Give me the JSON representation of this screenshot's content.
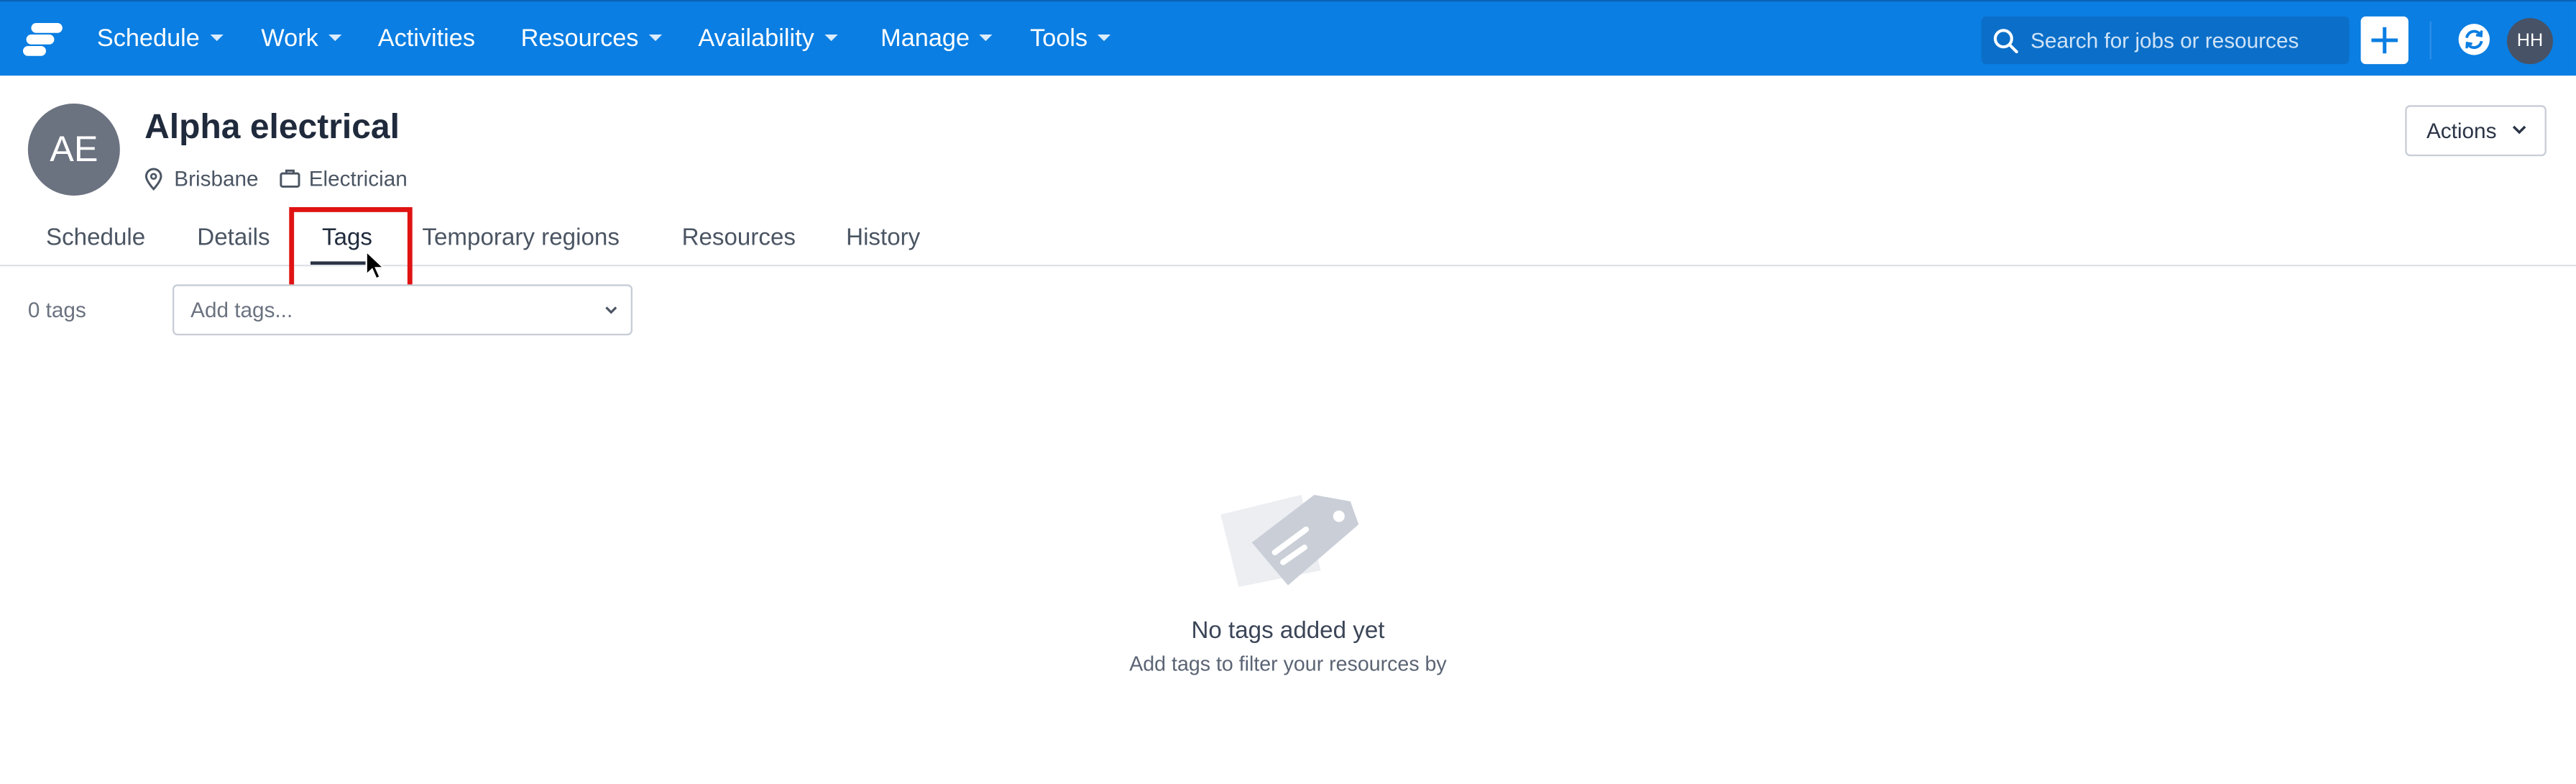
{
  "topbar": {
    "nav": [
      {
        "label": "Schedule"
      },
      {
        "label": "Work"
      },
      {
        "label": "Activities"
      },
      {
        "label": "Resources"
      },
      {
        "label": "Availability"
      },
      {
        "label": "Manage"
      },
      {
        "label": "Tools"
      }
    ],
    "search_placeholder": "Search for jobs or resources",
    "user_initials": "HH",
    "brand_color": "#0a7ee2"
  },
  "resource": {
    "initials": "AE",
    "name": "Alpha electrical",
    "location": "Brisbane",
    "role": "Electrician",
    "actions_label": "Actions"
  },
  "tabs": [
    {
      "label": "Schedule"
    },
    {
      "label": "Details"
    },
    {
      "label": "Tags",
      "active": true
    },
    {
      "label": "Temporary regions"
    },
    {
      "label": "Resources"
    },
    {
      "label": "History"
    }
  ],
  "tags": {
    "count_label": "0 tags",
    "select_placeholder": "Add tags..."
  },
  "empty_state": {
    "title": "No tags added yet",
    "subtitle": "Add tags to filter your resources by"
  }
}
